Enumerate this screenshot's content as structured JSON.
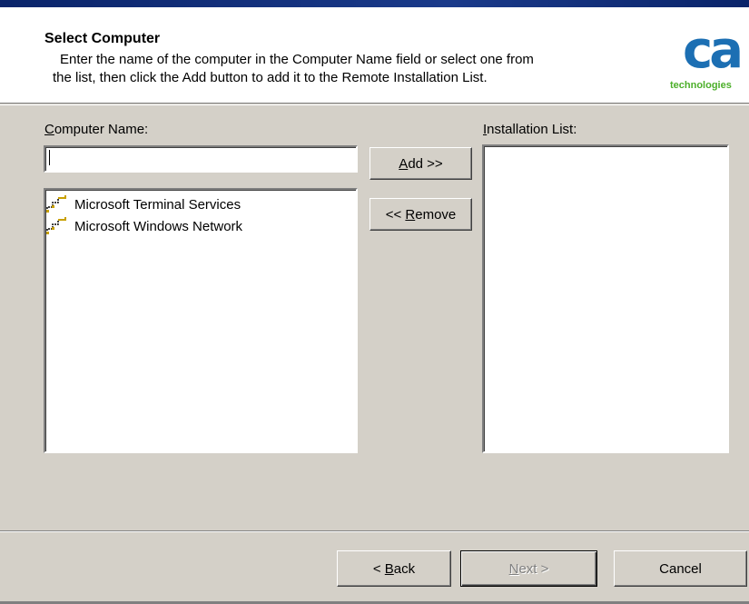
{
  "header": {
    "title": "Select Computer",
    "description_line1": "Enter the name of the computer in the Computer Name field or select one from",
    "description_line2": "the list, then click the Add button to add it to the Remote Installation List.",
    "logo_mark": "ca",
    "logo_text": "technologies"
  },
  "computer_name": {
    "label_prefix": "",
    "label_mnemonic": "C",
    "label_rest": "omputer Name:",
    "value": ""
  },
  "network_tree": {
    "items": [
      {
        "label": "Microsoft Terminal Services",
        "icon": "network-icon"
      },
      {
        "label": "Microsoft Windows Network",
        "icon": "network-icon"
      }
    ]
  },
  "installation_list": {
    "label_mnemonic": "I",
    "label_rest": "nstallation List:",
    "items": []
  },
  "buttons": {
    "add_mnemonic": "A",
    "add_rest": "dd >>",
    "remove_prefix": "<< ",
    "remove_mnemonic": "R",
    "remove_rest": "emove",
    "back_prefix": "< ",
    "back_mnemonic": "B",
    "back_rest": "ack",
    "next_mnemonic": "N",
    "next_rest": "ext >",
    "cancel": "Cancel"
  },
  "colors": {
    "dialog_bg": "#d4d0c8",
    "logo_blue": "#1c6fb3",
    "logo_green": "#4caf2a"
  }
}
